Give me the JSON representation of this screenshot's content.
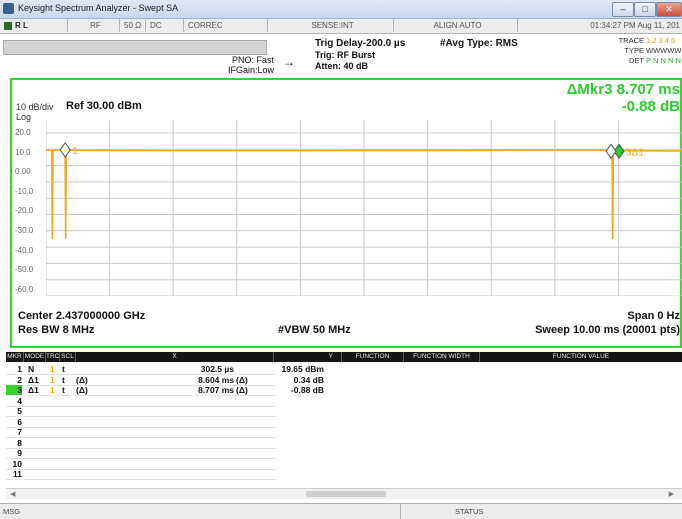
{
  "window": {
    "title": "Keysight Spectrum Analyzer - Swept SA",
    "btn_min": "–",
    "btn_max": "□",
    "btn_close": "✕"
  },
  "status_row": {
    "mode": "R L",
    "rf": "RF",
    "impedance": "50 Ω",
    "coupling": "DC",
    "correc": "CORREC",
    "sense": "SENSE:INT",
    "align": "ALIGN AUTO",
    "datetime": "01:34:27 PM Aug 11, 201"
  },
  "settings": {
    "pno": "PNO: Fast",
    "ifgain": "IFGain:Low",
    "trig_delay": "Trig Delay-200.0 µs",
    "trig": "Trig: RF Burst",
    "atten": "Atten: 40 dB",
    "avg_type": "#Avg Type: RMS",
    "trace_label": "TRACE",
    "trace_vals": "1 2 3 4 5",
    "type_label": "TYPE",
    "type_vals": "WWWWW",
    "det_label": "DET",
    "det_vals": "P N N N N"
  },
  "graph": {
    "marker_label": "ΔMkr3 8.707 ms",
    "marker_value": "-0.88 dB",
    "scale": "10 dB/div",
    "ref": "Ref 30.00 dBm",
    "log": "Log",
    "y_ticks": [
      "20.0",
      "10.0",
      "0.00",
      "-10.0",
      "-20.0",
      "-30.0",
      "-40.0",
      "-50.0",
      "-60.0"
    ],
    "marker1_label": "1",
    "marker3_label": "3Δ1",
    "center": "Center 2.437000000 GHz",
    "span": "Span 0 Hz",
    "res_bw": "Res BW 8 MHz",
    "vbw": "#VBW 50 MHz",
    "sweep": "Sweep  10.00 ms (20001 pts)",
    "trace_color": "#f5a623",
    "marker_color": "#2ecc2e",
    "frame_color": "#39d12a"
  },
  "chart_data": {
    "type": "line",
    "xlabel": "",
    "ylabel": "",
    "x_unit": "ms",
    "xlim": [
      0,
      10
    ],
    "ylim": [
      -70,
      30
    ],
    "series": [
      {
        "x": [
          0,
          0.09,
          0.1,
          0.11,
          0.3,
          0.31,
          0.32,
          0.35,
          0.5,
          1.0,
          2.0,
          3.0,
          4.0,
          5.0,
          6.0,
          7.0,
          8.0,
          8.9,
          8.91,
          8.92,
          8.95,
          9.1,
          9.5,
          10.0
        ],
        "y": [
          19.5,
          19.5,
          -35,
          19.5,
          19.65,
          -35,
          19.6,
          19.6,
          19.4,
          19.3,
          19.2,
          19.2,
          19.2,
          19.3,
          19.3,
          19.4,
          19.5,
          19.5,
          -35,
          19.3,
          19.3,
          19.2,
          19.1,
          19.0
        ]
      }
    ],
    "markers": [
      {
        "label": "1",
        "x": 0.3025,
        "y": 19.65
      },
      {
        "label": "3Δ1",
        "x": 9.0095,
        "y": 18.77
      }
    ]
  },
  "table": {
    "headers": [
      "MKR",
      "MODE",
      "TRC",
      "SCL",
      "X",
      "Y",
      "FUNCTION",
      "FUNCTION WIDTH",
      "FUNCTION VALUE"
    ],
    "rows": [
      {
        "mkr": "1",
        "mode": "N",
        "trc": "1",
        "scl": "t",
        "delta": "",
        "x": "302.5 µs",
        "xd": "",
        "y": "19.65 dBm"
      },
      {
        "mkr": "2",
        "mode": "Δ1",
        "trc": "1",
        "scl": "t",
        "delta": "(Δ)",
        "x": "8.604 ms",
        "xd": "(Δ)",
        "y": "0.34 dB"
      },
      {
        "mkr": "3",
        "mode": "Δ1",
        "trc": "1",
        "scl": "t",
        "delta": "(Δ)",
        "x": "8.707 ms",
        "xd": "(Δ)",
        "y": "-0.88 dB"
      },
      {
        "mkr": "4"
      },
      {
        "mkr": "5"
      },
      {
        "mkr": "6"
      },
      {
        "mkr": "7"
      },
      {
        "mkr": "8"
      },
      {
        "mkr": "9"
      },
      {
        "mkr": "10"
      },
      {
        "mkr": "11"
      }
    ]
  },
  "footer": {
    "msg": "MSG",
    "status": "STATUS"
  }
}
